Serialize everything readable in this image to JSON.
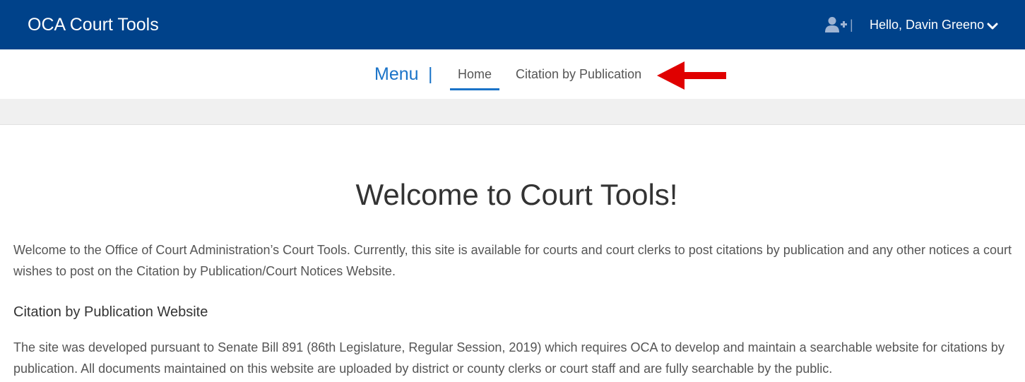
{
  "header": {
    "brand": "OCA Court Tools",
    "separator": "|",
    "user_greeting": "Hello, Davin Greeno"
  },
  "nav": {
    "menu_label": "Menu",
    "menu_separator": "|",
    "items": [
      {
        "label": "Home",
        "active": true
      },
      {
        "label": "Citation by Publication",
        "active": false
      }
    ]
  },
  "main": {
    "title": "Welcome to Court Tools!",
    "intro": "Welcome to the Office of Court Administration’s Court Tools. Currently, this site is available for courts and court clerks to post citations by publication and any other notices a court wishes to post on the Citation by Publication/Court Notices Website.",
    "section_heading": "Citation by Publication Website",
    "section_body": "The site was developed pursuant to Senate Bill 891 (86th Legislature, Regular Session, 2019) which requires OCA to develop and maintain a searchable website for citations by publication. All documents maintained on this website are uploaded by district or county clerks or court staff and are fully searchable by the public."
  },
  "icons": {
    "add_user": "user-plus-icon",
    "dropdown": "chevron-down-icon",
    "annotation": "red-arrow-icon"
  },
  "colors": {
    "header_bg": "#00428a",
    "accent": "#1a73c8",
    "annotation": "#e00000"
  }
}
